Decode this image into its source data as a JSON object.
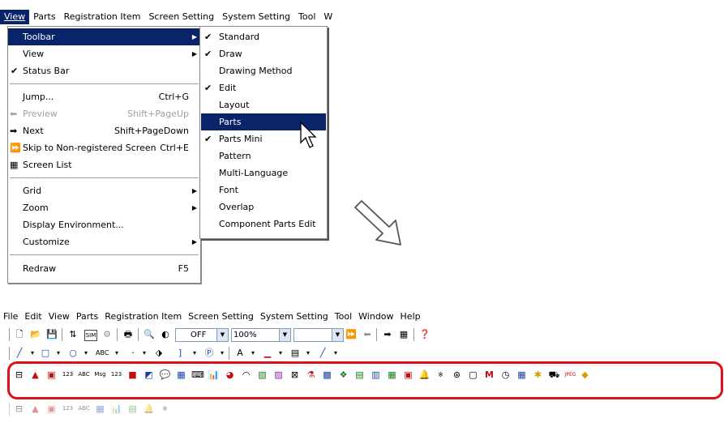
{
  "top_menu": [
    "View",
    "Parts",
    "Registration Item",
    "Screen Setting",
    "System Setting",
    "Tool",
    "W"
  ],
  "view_menu": [
    {
      "label": "Toolbar",
      "submenu": true,
      "highlighted": true
    },
    {
      "label": "View",
      "submenu": true
    },
    {
      "label": "Status Bar",
      "checked": true
    },
    {
      "label": "Jump...",
      "shortcut": "Ctrl+G"
    },
    {
      "label": "Preview",
      "shortcut": "Shift+PageUp",
      "disabled": true
    },
    {
      "label": "Next",
      "shortcut": "Shift+PageDown"
    },
    {
      "label": "Skip to Non-registered Screen",
      "shortcut": "Ctrl+E"
    },
    {
      "label": "Screen List"
    },
    {
      "label": "Grid",
      "submenu": true
    },
    {
      "label": "Zoom",
      "submenu": true
    },
    {
      "label": "Display Environment..."
    },
    {
      "label": "Customize",
      "submenu": true
    },
    {
      "label": "Redraw",
      "shortcut": "F5"
    }
  ],
  "toolbar_submenu": [
    {
      "label": "Standard",
      "checked": true
    },
    {
      "label": "Draw",
      "checked": true
    },
    {
      "label": "Drawing Method",
      "checked": false
    },
    {
      "label": "Edit",
      "checked": true
    },
    {
      "label": "Layout",
      "checked": false
    },
    {
      "label": "Parts",
      "checked": false,
      "highlighted": true
    },
    {
      "label": "Parts Mini",
      "checked": true
    },
    {
      "label": "Pattern",
      "checked": false
    },
    {
      "label": "Multi-Language",
      "checked": false
    },
    {
      "label": "Font",
      "checked": false
    },
    {
      "label": "Overlap",
      "checked": false
    },
    {
      "label": "Component Parts Edit",
      "checked": false
    }
  ],
  "bottom_menu": [
    "File",
    "Edit",
    "View",
    "Parts",
    "Registration Item",
    "Screen Setting",
    "System Setting",
    "Tool",
    "Window",
    "Help"
  ],
  "standard_toolbar": {
    "off_label": "OFF",
    "zoom_value": "100%"
  },
  "draw_toolbar": {
    "text_a": "A",
    "text_abc": "ABC"
  },
  "colors": {
    "menu_highlight": "#0a246a",
    "callout": "#e0101a"
  }
}
